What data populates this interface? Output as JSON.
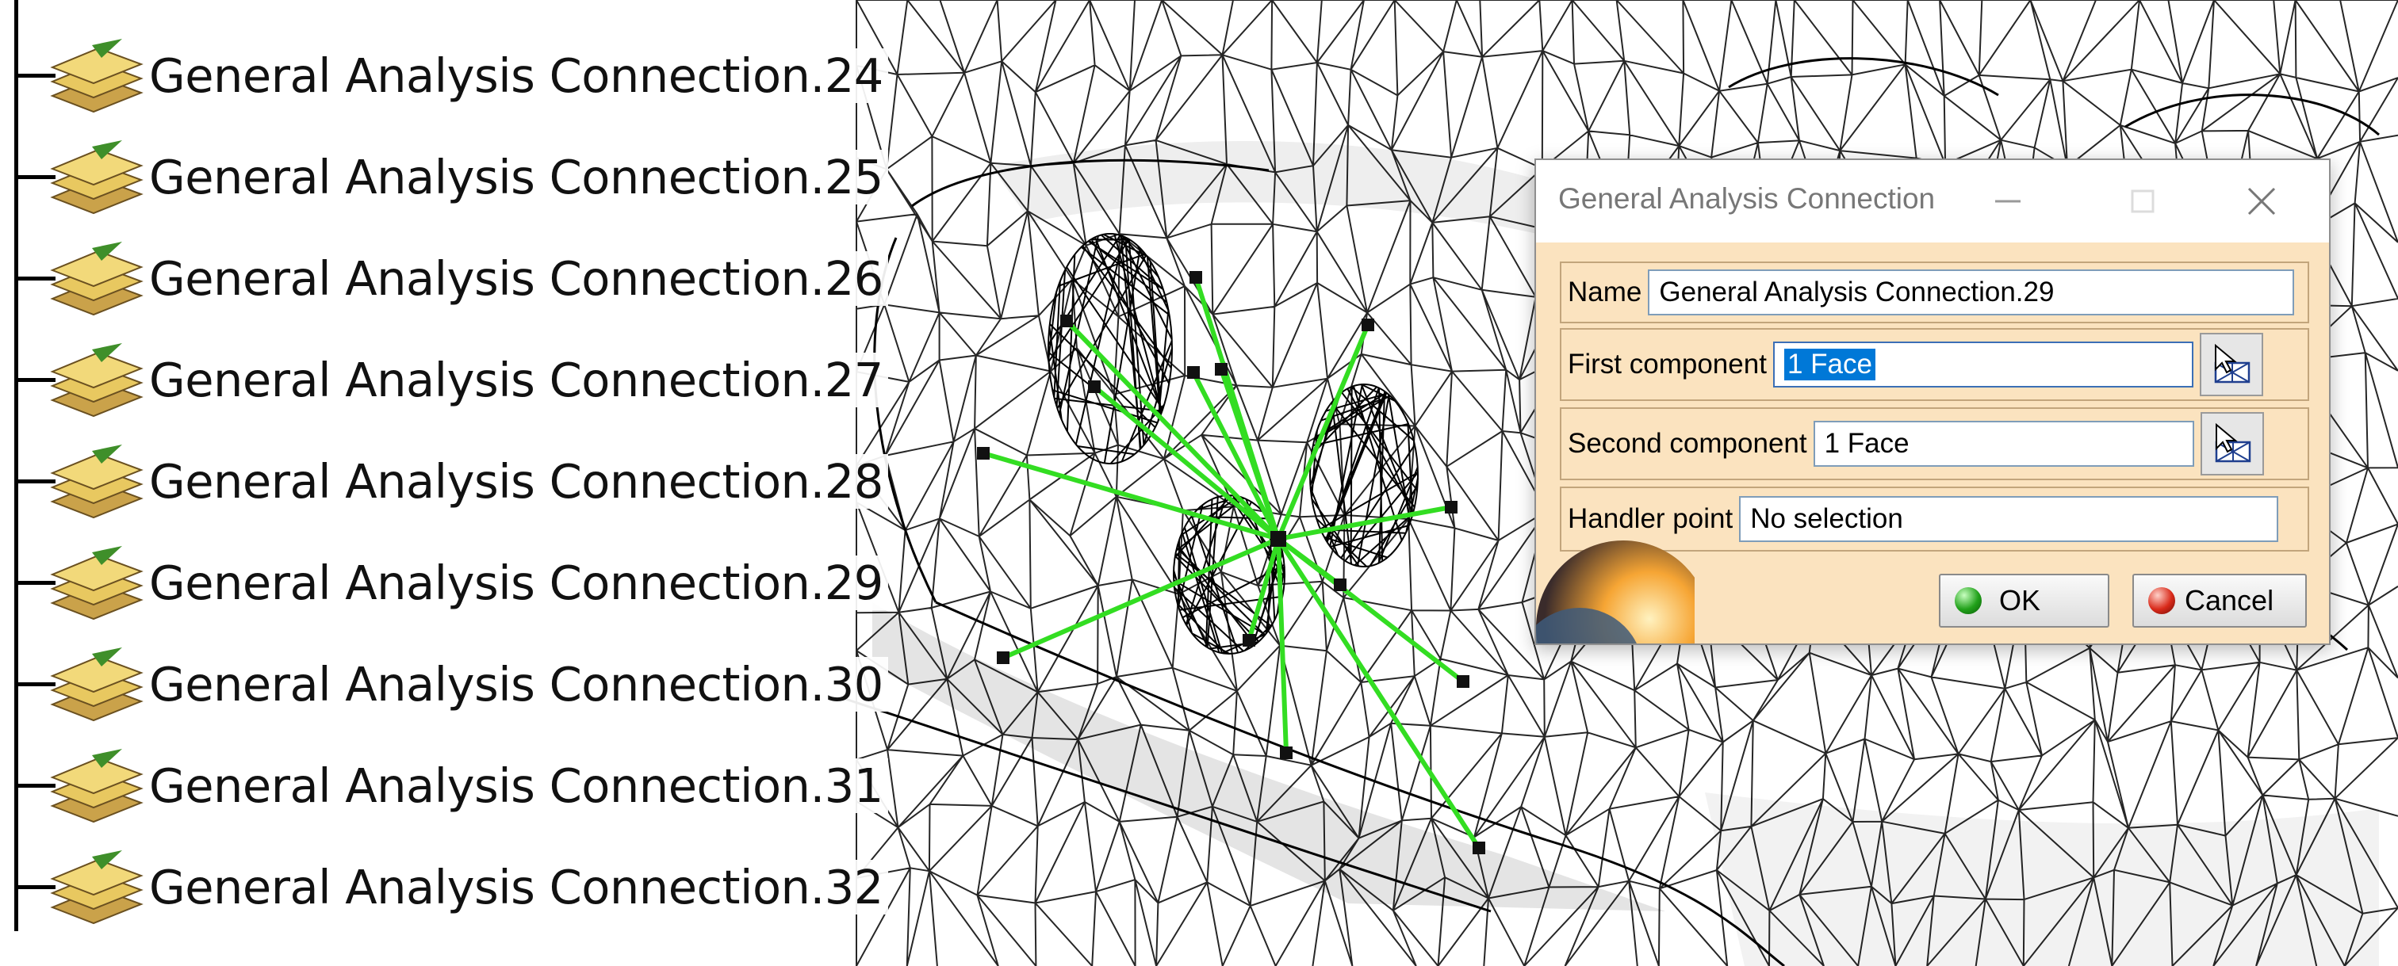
{
  "tree": {
    "items": [
      {
        "label": "General Analysis Connection.24"
      },
      {
        "label": "General Analysis Connection.25"
      },
      {
        "label": "General Analysis Connection.26"
      },
      {
        "label": "General Analysis Connection.27"
      },
      {
        "label": "General Analysis Connection.28"
      },
      {
        "label": "General Analysis Connection.29"
      },
      {
        "label": "General Analysis Connection.30"
      },
      {
        "label": "General Analysis Connection.31"
      },
      {
        "label": "General Analysis Connection.32"
      }
    ],
    "item_icon": "analysis-connection-icon"
  },
  "dialog": {
    "title": "General Analysis Connection",
    "name_label": "Name",
    "name_value": "General Analysis Connection.29",
    "first_label": "First component",
    "first_value": "1 Face",
    "second_label": "Second component",
    "second_value": "1 Face",
    "handler_label": "Handler point",
    "handler_value": "No selection",
    "ok_label": "OK",
    "cancel_label": "Cancel",
    "icons": {
      "minimize": "minimize-icon",
      "maximize": "maximize-icon",
      "close": "close-icon",
      "selector": "face-selection-icon",
      "ok": "ok-green-dot-icon",
      "cancel": "cancel-red-dot-icon"
    }
  },
  "colors": {
    "dialog_background": "#fbe3bf",
    "connection_lines": "#33dd22",
    "selection_highlight": "#0078d7",
    "mesh": "#000000",
    "tree_icon": "#d8b24a"
  }
}
